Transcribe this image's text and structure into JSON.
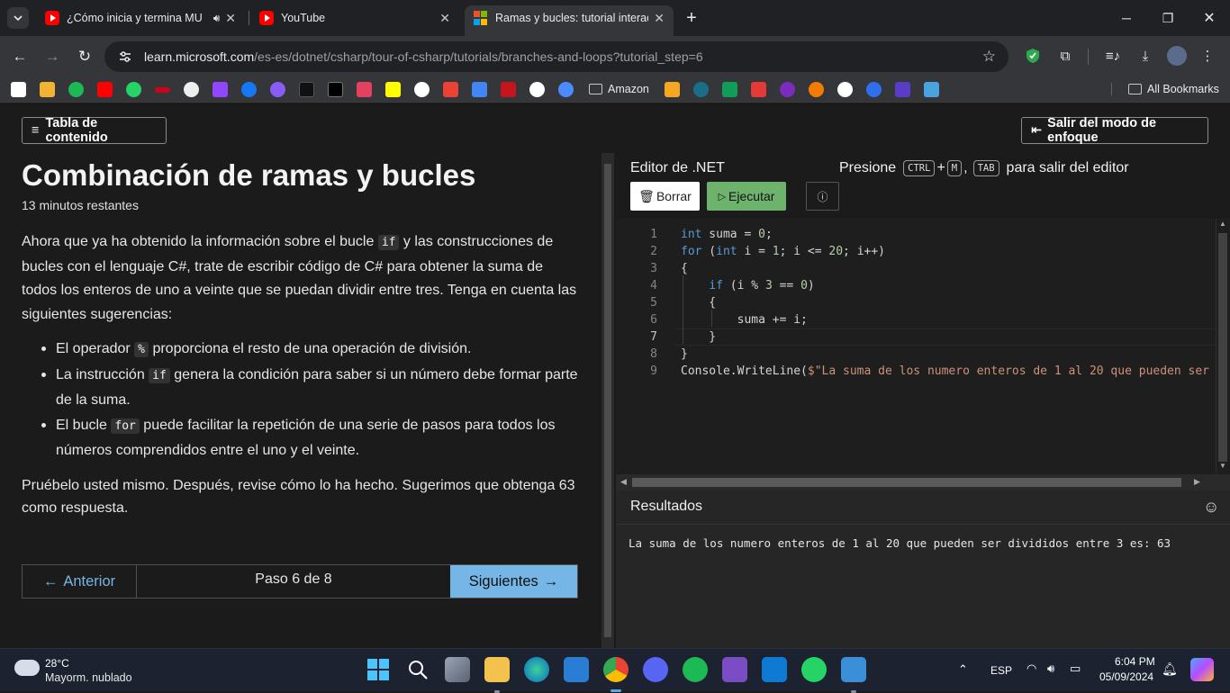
{
  "browser": {
    "tabs": [
      {
        "title": "¿Cómo inicia y termina MU",
        "icon": "youtube-icon",
        "audio": true
      },
      {
        "title": "YouTube",
        "icon": "youtube-icon"
      },
      {
        "title": "Ramas y bucles: tutorial interac",
        "icon": "microsoft-icon",
        "active": true
      }
    ],
    "url_host": "learn.microsoft.com",
    "url_path": "/es-es/dotnet/csharp/tour-of-csharp/tutorials/branches-and-loops?tutorial_step=6",
    "bookmarks_folder": "Amazon",
    "all_bookmarks": "All Bookmarks"
  },
  "page": {
    "toc_button": "Tabla de contenido",
    "focus_button": "Salir del modo de enfoque",
    "title": "Combinación de ramas y bucles",
    "time_left": "13 minutos restantes",
    "intro": {
      "before": "Ahora que ya ha obtenido la información sobre el bucle ",
      "code": "if",
      "after": " y las construcciones de bucles con el lenguaje C#, trate de escribir código de C# para obtener la suma de todos los enteros de uno a veinte que se puedan dividir entre tres. Tenga en cuenta las siguientes sugerencias:"
    },
    "hints": [
      {
        "before": "El operador ",
        "code": "%",
        "after": " proporciona el resto de una operación de división."
      },
      {
        "before": "La instrucción ",
        "code": "if",
        "after": " genera la condición para saber si un número debe formar parte de la suma."
      },
      {
        "before": "El bucle ",
        "code": "for",
        "after": " puede facilitar la repetición de una serie de pasos para todos los números comprendidos entre el uno y el veinte."
      }
    ],
    "outro": "Pruébelo usted mismo. Después, revise cómo lo ha hecho. Sugerimos que obtenga 63 como respuesta.",
    "pager": {
      "prev": "Anterior",
      "step": "Paso 6 de 8",
      "next": "Siguientes"
    }
  },
  "editor": {
    "title": "Editor de .NET",
    "hint_before": "Presione",
    "kbd1": "CTRL",
    "plus": "+",
    "kbd2": "M",
    "comma": ",",
    "kbd3": "TAB",
    "hint_after": "para salir del editor",
    "clear_button": "Borrar",
    "run_button": "Ejecutar",
    "line_numbers": [
      "1",
      "2",
      "3",
      "4",
      "5",
      "6",
      "7",
      "8",
      "9"
    ],
    "results_title": "Resultados",
    "results_output": "La suma de los numero enteros de 1 al 20 que pueden ser divididos entre 3 es: 63"
  },
  "taskbar": {
    "weather_temp": "28°C",
    "weather_desc": "Mayorm. nublado",
    "lang": "ESP",
    "time": "6:04 PM",
    "date": "05/09/2024"
  }
}
